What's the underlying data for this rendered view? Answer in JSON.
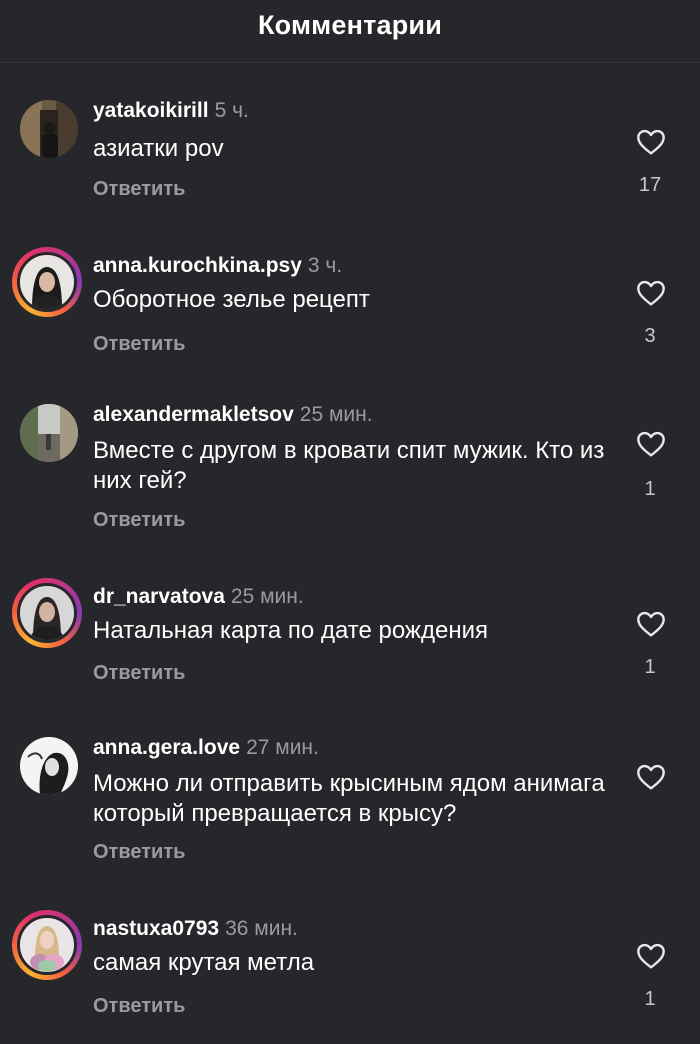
{
  "header": {
    "title": "Комментарии"
  },
  "comments": [
    {
      "username": "yatakoikirill",
      "time": "5 ч.",
      "text": "азиатки pov",
      "reply": "Ответить",
      "likes": "17",
      "avatar_icon": "user-photo-dark-doorway",
      "story_ring": false
    },
    {
      "username": "anna.kurochkina.psy",
      "time": "3 ч.",
      "text": "Оборотное зелье рецепт",
      "reply": "Ответить",
      "likes": "3",
      "avatar_icon": "user-photo-woman-dark-hair",
      "story_ring": true
    },
    {
      "username": "alexandermakletsov",
      "time": "25 мин.",
      "text": "Вместе с другом в кровати спит мужик. Кто из них гей?",
      "reply": "Ответить",
      "likes": "1",
      "avatar_icon": "user-photo-street",
      "story_ring": false
    },
    {
      "username": "dr_narvatova",
      "time": "25 мин.",
      "text": "Натальная карта по дате рождения",
      "reply": "Ответить",
      "likes": "1",
      "avatar_icon": "user-photo-woman-portrait",
      "story_ring": true
    },
    {
      "username": "anna.gera.love",
      "time": "27 мин.",
      "text": "Можно ли отправить крысиным ядом анимага который превращается в крысу?",
      "reply": "Ответить",
      "likes": "",
      "avatar_icon": "user-photo-bw-profile",
      "story_ring": false
    },
    {
      "username": "nastuxa0793",
      "time": "36 мин.",
      "text": "самая крутая метла",
      "reply": "Ответить",
      "likes": "1",
      "avatar_icon": "user-photo-woman-flowers",
      "story_ring": true
    }
  ],
  "colors": {
    "background": "#26272b",
    "text_primary": "#ffffff",
    "text_secondary": "#9a9ba0",
    "story_ring": [
      "#f9b233",
      "#e1306c",
      "#833ab4"
    ]
  }
}
